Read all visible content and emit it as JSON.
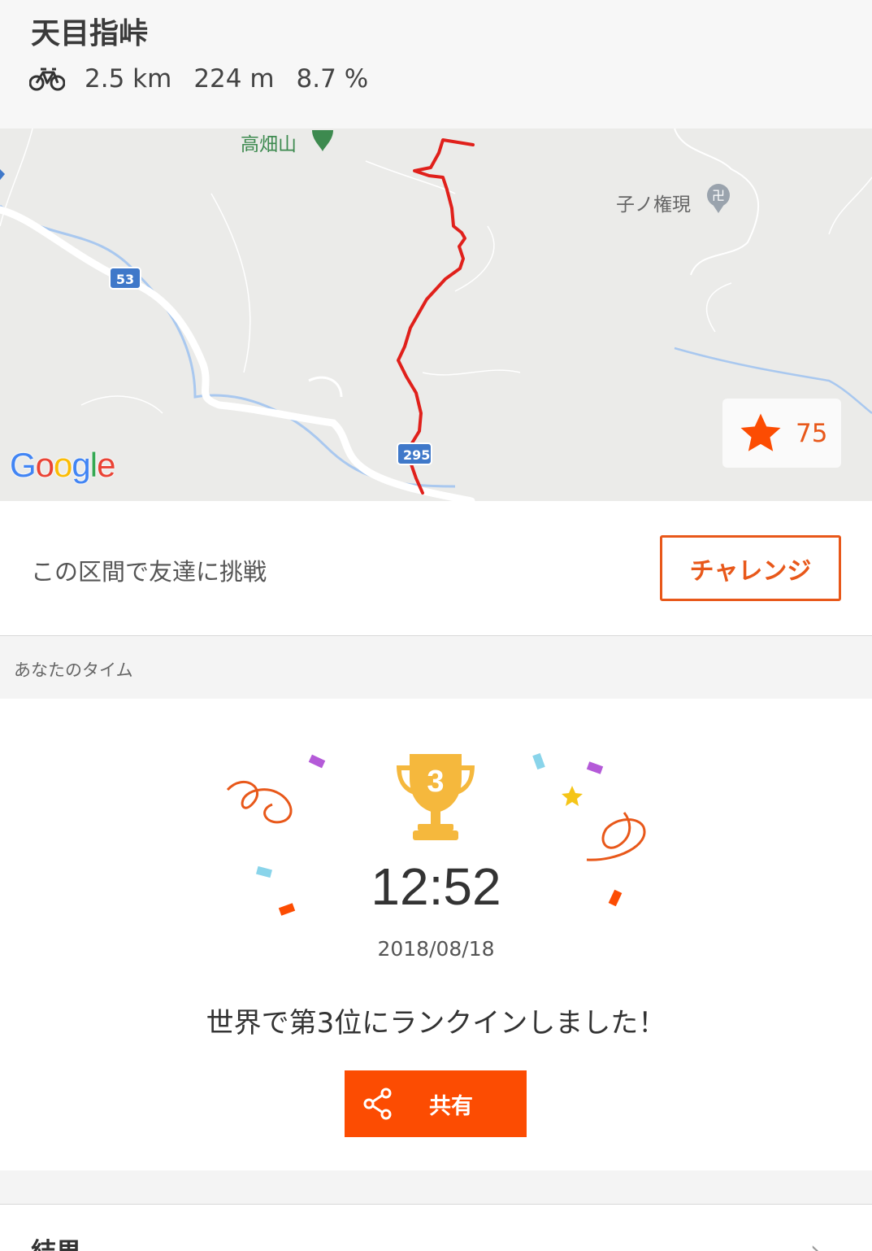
{
  "segment": {
    "name": "天目指峠",
    "icon": "bike-icon",
    "distance": "2.5 km",
    "elevation": "224 m",
    "grade": "8.7 %"
  },
  "map": {
    "poi_mountain": "高畑山",
    "poi_shrine": "子ノ権現",
    "route_53": "53",
    "route_295": "295",
    "attribution": "Google",
    "star_count": "75",
    "route_color": "#e0201b"
  },
  "challenge": {
    "prompt": "この区間で友達に挑戦",
    "button_label": "チャレンジ"
  },
  "your_time": {
    "section_title": "あなたのタイム",
    "rank_badge": "3",
    "time": "12:52",
    "date": "2018/08/18",
    "message": "世界で第3位にランクインしました！",
    "share_label": "共有"
  },
  "results": {
    "label": "結果"
  },
  "colors": {
    "accent": "#fc4c02",
    "trophy": "#f5b83d"
  }
}
